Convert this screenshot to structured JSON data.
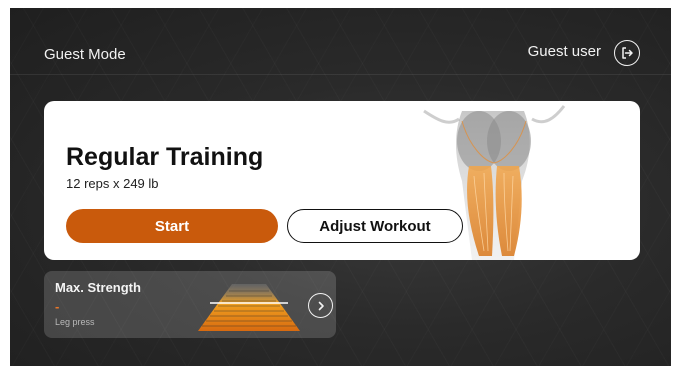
{
  "header": {
    "mode": "Guest Mode",
    "user": "Guest user",
    "logout_icon": "logout-icon"
  },
  "training_card": {
    "title": "Regular Training",
    "subtitle": "12 reps x 249 lb",
    "start_label": "Start",
    "adjust_label": "Adjust Workout",
    "accent_color": "#c95a0c"
  },
  "strength_card": {
    "title": "Max. Strength",
    "value": "-",
    "exercise": "Leg press",
    "arrow_icon": "chevron-right-icon"
  }
}
